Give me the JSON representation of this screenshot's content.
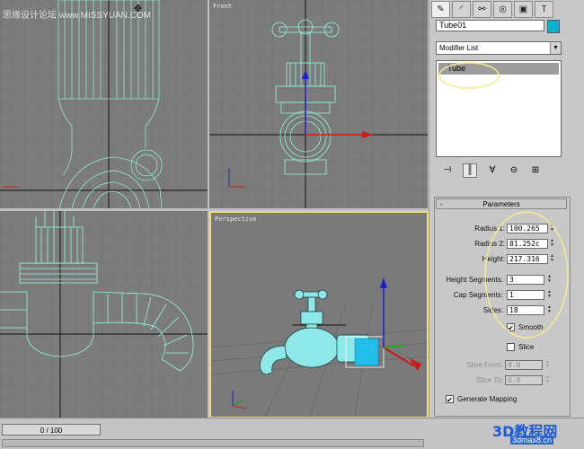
{
  "viewports": {
    "top_left_label": "",
    "front_label": "Front",
    "bottom_left_label": "",
    "perspective_label": "Perspective"
  },
  "watermark": "思缘设计论坛 www.MISSYUAN.COM",
  "command_panel": {
    "tabs": [
      {
        "icon": "create-icon",
        "glyph": "✎"
      },
      {
        "icon": "modify-icon",
        "glyph": "◜"
      },
      {
        "icon": "hierarchy-icon",
        "glyph": "⚯"
      },
      {
        "icon": "motion-icon",
        "glyph": "◎"
      },
      {
        "icon": "display-icon",
        "glyph": "▣"
      },
      {
        "icon": "utilities-icon",
        "glyph": "T"
      }
    ],
    "object_name": "Tube01",
    "object_color": "#00b4d0",
    "modifier_list_label": "Modifier List",
    "stack_items": [
      "Tube"
    ],
    "stack_tools": [
      {
        "icon": "pin-stack-icon",
        "glyph": "⊣"
      },
      {
        "icon": "show-end-result-icon",
        "glyph": "║"
      },
      {
        "icon": "make-unique-icon",
        "glyph": "∀"
      },
      {
        "icon": "remove-modifier-icon",
        "glyph": "⊖"
      },
      {
        "icon": "configure-modifier-sets-icon",
        "glyph": "⊞"
      }
    ]
  },
  "parameters": {
    "header": "Parameters",
    "collapse_glyph": "-",
    "radius1_label": "Radius 1:",
    "radius1_value": "100.265",
    "radius2_label": "Radius 2:",
    "radius2_value": "81.252c",
    "height_label": "Height:",
    "height_value": "217.316",
    "height_segments_label": "Height Segments:",
    "height_segments_value": "3",
    "cap_segments_label": "Cap Segments:",
    "cap_segments_value": "1",
    "sides_label": "Sides:",
    "sides_value": "18",
    "smooth_label": "Smooth",
    "smooth_checked": true,
    "slice_label": "Slice",
    "slice_checked": false,
    "slice_from_label": "Slice From:",
    "slice_from_value": "0.0",
    "slice_to_label": "Slice To:",
    "slice_to_value": "0.0",
    "generate_mapping_label": "Generate Mapping",
    "generate_mapping_checked": true
  },
  "timeline": {
    "frame_display": "0 / 100"
  },
  "branding": {
    "logo_main": "3D教程网",
    "logo_sub": "3dmax8.cn"
  },
  "colors": {
    "wire": "#7ff0d8",
    "viewport_bg": "#7c7c7c",
    "active_border": "#e8e070",
    "annotation": "#f0ec90"
  }
}
